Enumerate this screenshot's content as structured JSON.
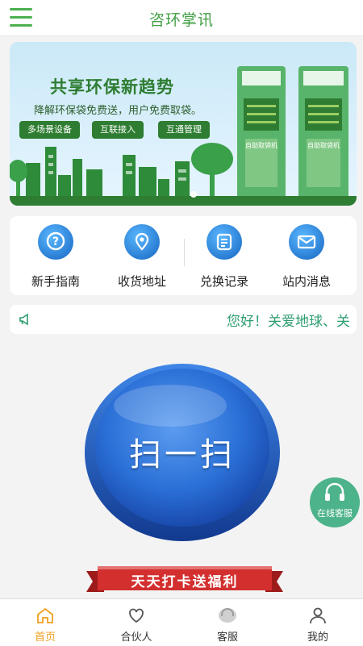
{
  "header": {
    "title": "咨环掌讯"
  },
  "banner": {
    "headline": "共享环保新趋势",
    "subline": "降解环保袋免费送，用户免费取袋。",
    "tags": [
      "多场景设备",
      "互联接入",
      "互通管理"
    ],
    "machine_text_1": "自助取袋机",
    "machine_text_2": "自助取袋机"
  },
  "quick_menu": [
    {
      "label": "新手指南",
      "icon": "help-icon"
    },
    {
      "label": "收货地址",
      "icon": "location-pin-icon"
    },
    {
      "label": "兑换记录",
      "icon": "record-list-icon"
    },
    {
      "label": "站内消息",
      "icon": "mail-icon"
    }
  ],
  "notice": {
    "text": "您好！关爱地球、关",
    "icon": "megaphone-icon"
  },
  "scan_button": {
    "label": "扫一扫"
  },
  "online_service": {
    "label": "在线客服",
    "icon": "headset-icon"
  },
  "promo_ribbon": {
    "text": "天天打卡送福利"
  },
  "tabbar": [
    {
      "label": "首页",
      "icon": "home-icon",
      "active": true
    },
    {
      "label": "合伙人",
      "icon": "heart-icon",
      "active": false
    },
    {
      "label": "客服",
      "icon": "headset-icon",
      "active": false
    },
    {
      "label": "我的",
      "icon": "user-icon",
      "active": false
    }
  ],
  "colors": {
    "accent": "#43a047",
    "tab_active": "#f0a020",
    "notice_text": "#2e9d6f",
    "scan_blue": "#2a6fd6"
  }
}
